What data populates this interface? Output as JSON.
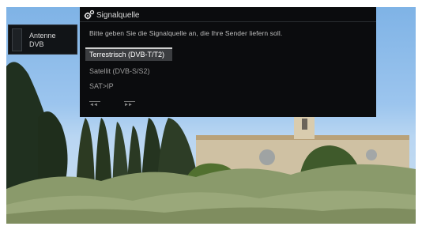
{
  "source_tile": {
    "name": "Antenne",
    "sub": "DVB"
  },
  "dialog": {
    "icon": "gear-icon",
    "title": "Signalquelle",
    "prompt": "Bitte geben Sie die Signalquelle an, die Ihre Sender liefern soll.",
    "options": [
      {
        "label": "Terrestrisch (DVB-T/T2)",
        "selected": true
      },
      {
        "label": "Satellit (DVB-S/S2)",
        "selected": false
      },
      {
        "label": "SAT>IP",
        "selected": false
      }
    ],
    "nav": {
      "prev_glyph": "◄◄",
      "next_glyph": "►►"
    }
  }
}
